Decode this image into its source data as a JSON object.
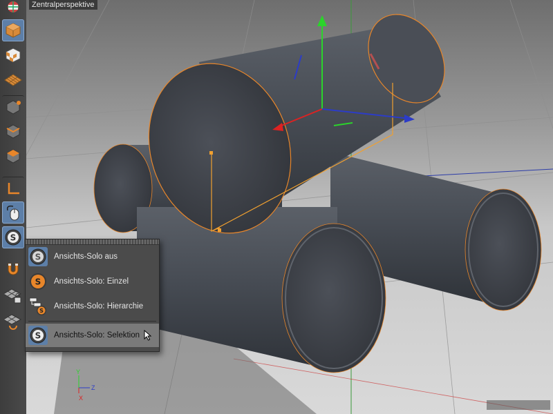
{
  "viewport": {
    "title": "Zentralperspektive",
    "axis_labels": {
      "y": "Y",
      "z": "Z",
      "x": "X"
    }
  },
  "toolbar": {
    "tools": [
      {
        "name": "view-cube-icon"
      },
      {
        "name": "model-mode-icon"
      },
      {
        "name": "texture-mode-icon"
      },
      {
        "name": "workplane-icon"
      },
      {
        "name": "points-mode-icon"
      },
      {
        "name": "edges-mode-icon"
      },
      {
        "name": "polygons-mode-icon"
      },
      {
        "name": "axis-mode-icon"
      },
      {
        "name": "tweak-mouse-icon"
      },
      {
        "name": "view-solo-icon"
      },
      {
        "name": "snap-magnet-icon"
      },
      {
        "name": "workplane-lock-icon"
      },
      {
        "name": "workplane-align-icon"
      }
    ]
  },
  "solo_menu": {
    "items": [
      {
        "label": "Ansichts-Solo aus",
        "icon": "solo-off-icon"
      },
      {
        "label": "Ansichts-Solo: Einzel",
        "icon": "solo-single-icon"
      },
      {
        "label": "Ansichts-Solo: Hierarchie",
        "icon": "solo-hierarchy-icon"
      },
      {
        "label": "Ansichts-Solo: Selektion",
        "icon": "solo-selection-icon"
      }
    ],
    "highlighted_index": 3
  },
  "colors": {
    "accent_blue": "#5d7fa8",
    "solo_orange": "#e8862a",
    "selection_orange": "#f0a030"
  }
}
